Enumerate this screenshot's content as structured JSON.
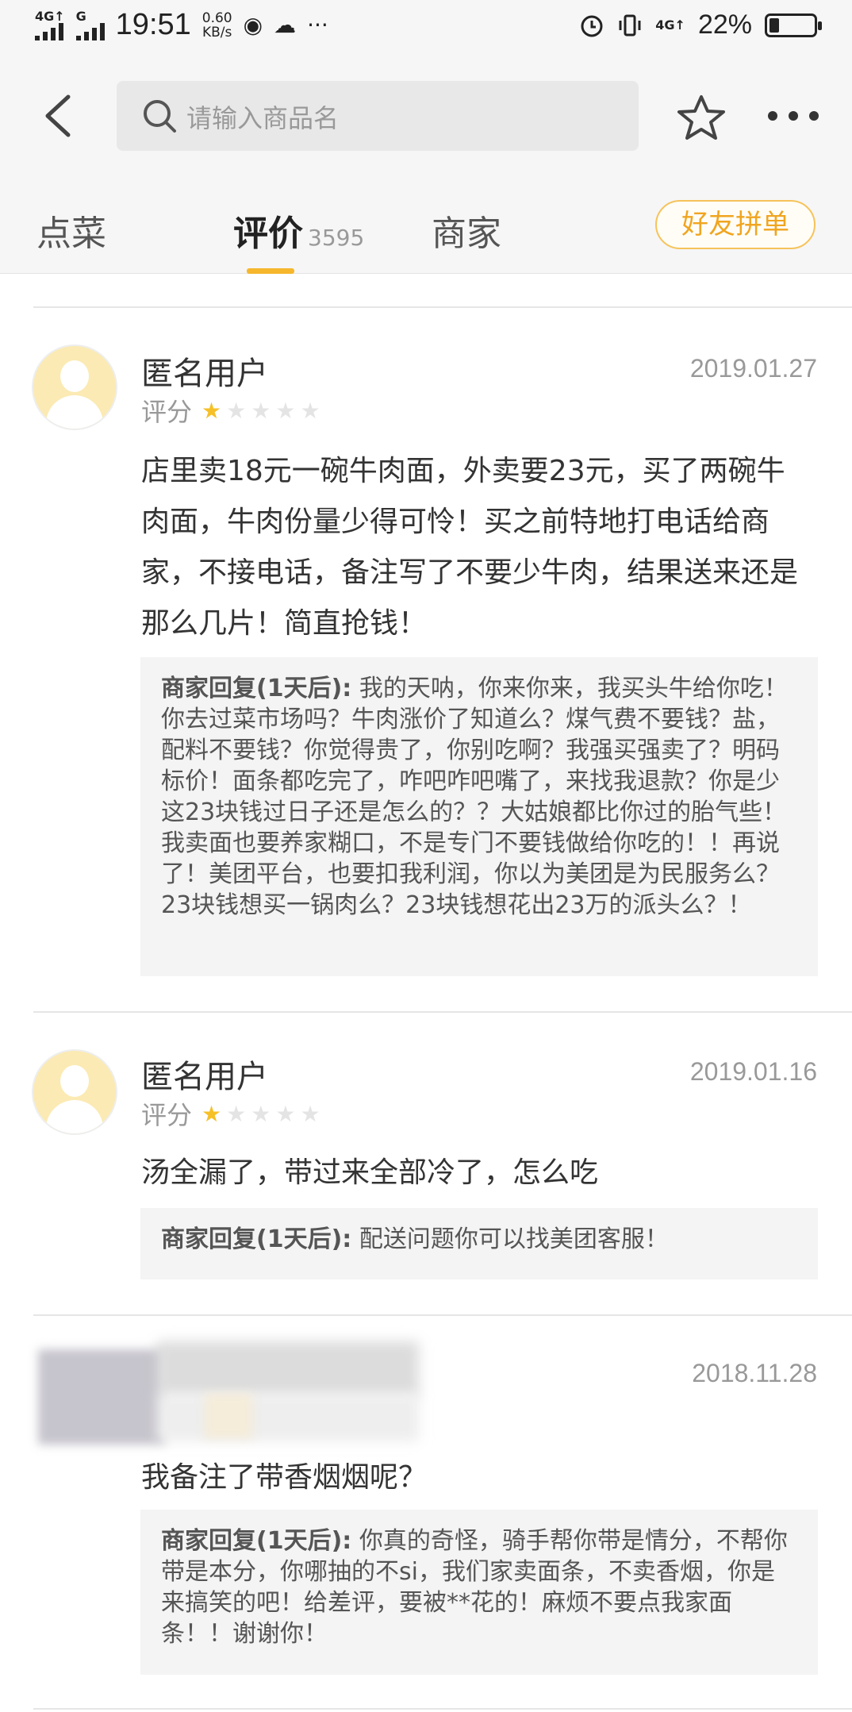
{
  "status_bar": {
    "signal_label_1": "4G↑",
    "signal_label_2": "G",
    "time": "19:51",
    "speed_value": "0.60",
    "speed_unit": "KB/s",
    "net_right": "4G↑",
    "battery_text": "22%",
    "battery_level": 0.22
  },
  "header": {
    "search_placeholder": "请输入商品名"
  },
  "tabs": {
    "items": [
      {
        "label": "点菜"
      },
      {
        "label": "评价",
        "count": "3595"
      },
      {
        "label": "商家"
      }
    ],
    "active_index": 1,
    "group_button": "好友拼单"
  },
  "reviews": [
    {
      "user": "匿名用户",
      "date": "2019.01.27",
      "rating_label": "评分",
      "stars": 1,
      "text": "店里卖18元一碗牛肉面，外卖要23元，买了两碗牛肉面，牛肉份量少得可怜！买之前特地打电话给商家，不接电话，备注写了不要少牛肉，结果送来还是那么几片！简直抢钱！",
      "reply_label": "商家回复(1天后):",
      "reply_text": " 我的天呐，你来你来，我买头牛给你吃！你去过菜市场吗？牛肉涨价了知道么？煤气费不要钱？盐，配料不要钱？你觉得贵了，你别吃啊？我强买强卖了？明码标价！面条都吃完了，咋吧咋吧嘴了，来找我退款？你是少这23块钱过日子还是怎么的？？大姑娘都比你过的胎气些！我卖面也要养家糊口，不是专门不要钱做给你吃的！！再说了！美团平台，也要扣我利润，你以为美团是为民服务么？23块钱想买一锅肉么？23块钱想花出23万的派头么？！"
    },
    {
      "user": "匿名用户",
      "date": "2019.01.16",
      "rating_label": "评分",
      "stars": 1,
      "text": "汤全漏了，带过来全部冷了，怎么吃",
      "reply_label": "商家回复(1天后):",
      "reply_text": " 配送问题你可以找美团客服！"
    },
    {
      "user": "",
      "date": "2018.11.28",
      "text": "我备注了带香烟烟呢？",
      "reply_label": "商家回复(1天后):",
      "reply_text": " 你真的奇怪，骑手帮你带是情分，不帮你带是本分，你哪抽的不si，我们家卖面条，不卖香烟，你是来搞笑的吧！给差评，要被**花的！麻烦不要点我家面条！！谢谢你！"
    }
  ],
  "colors": {
    "accent": "#f6b72d",
    "star_on": "#f6c028",
    "star_off": "#e4e4e4",
    "header_bg": "#f6f6f6",
    "reply_bg": "#f4f4f4"
  }
}
